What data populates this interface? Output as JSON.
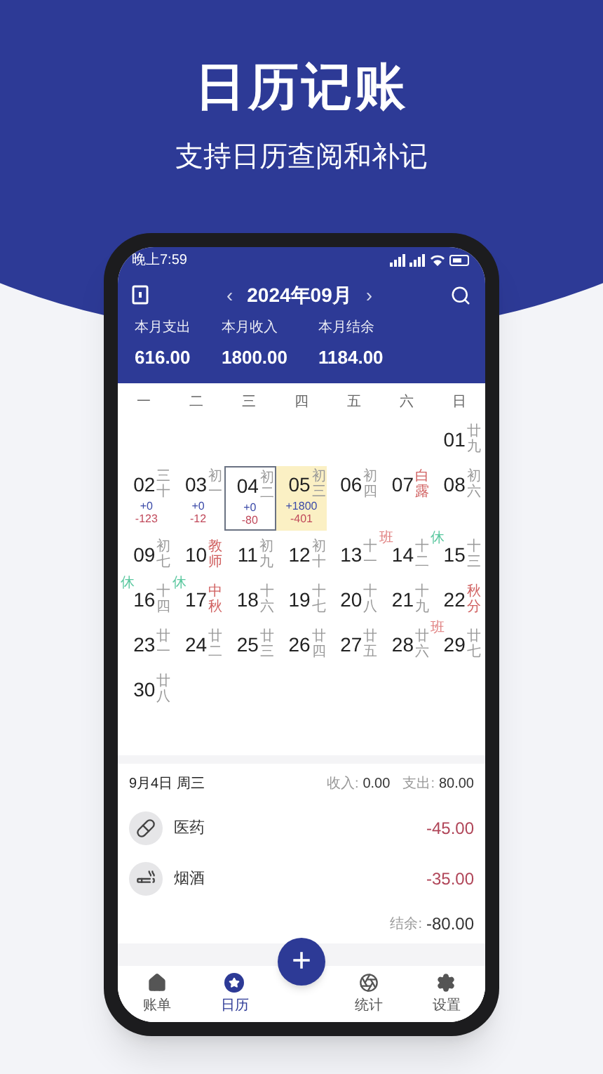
{
  "banner": {
    "title": "日历记账",
    "subtitle": "支持日历查阅和补记"
  },
  "status_bar": {
    "time": "晚上7:59"
  },
  "header": {
    "prev": "‹",
    "month": "2024年09月",
    "next": "›"
  },
  "summary": [
    {
      "label": "本月支出",
      "value": "616.00"
    },
    {
      "label": "本月收入",
      "value": "1800.00"
    },
    {
      "label": "本月结余",
      "value": "1184.00"
    }
  ],
  "weekdays": [
    "一",
    "二",
    "三",
    "四",
    "五",
    "六",
    "日"
  ],
  "days": [
    {
      "kind": "empty"
    },
    {
      "kind": "empty"
    },
    {
      "kind": "empty"
    },
    {
      "kind": "empty"
    },
    {
      "kind": "empty"
    },
    {
      "kind": "empty"
    },
    {
      "kind": "day",
      "day": "01",
      "lunar": "廿九",
      "holiday": false,
      "selected": false,
      "today": false
    },
    {
      "kind": "day",
      "day": "02",
      "lunar": "三十",
      "holiday": false,
      "selected": false,
      "today": false,
      "income": "+0",
      "expense": "-123"
    },
    {
      "kind": "day",
      "day": "03",
      "lunar": "初一",
      "holiday": false,
      "selected": false,
      "today": false,
      "income": "+0",
      "expense": "-12"
    },
    {
      "kind": "day",
      "day": "04",
      "lunar": "初二",
      "holiday": false,
      "selected": true,
      "today": false,
      "income": "+0",
      "expense": "-80"
    },
    {
      "kind": "day",
      "day": "05",
      "lunar": "初三",
      "holiday": false,
      "selected": false,
      "today": true,
      "income": "+1800",
      "expense": "-401"
    },
    {
      "kind": "day",
      "day": "06",
      "lunar": "初四",
      "holiday": false,
      "selected": false,
      "today": false
    },
    {
      "kind": "day",
      "day": "07",
      "lunar": "白露",
      "holiday": true,
      "selected": false,
      "today": false
    },
    {
      "kind": "day",
      "day": "08",
      "lunar": "初六",
      "holiday": false,
      "selected": false,
      "today": false
    },
    {
      "kind": "day",
      "day": "09",
      "lunar": "初七",
      "holiday": false,
      "selected": false,
      "today": false
    },
    {
      "kind": "day",
      "day": "10",
      "lunar": "教师",
      "holiday": true,
      "selected": false,
      "today": false
    },
    {
      "kind": "day",
      "day": "11",
      "lunar": "初九",
      "holiday": false,
      "selected": false,
      "today": false
    },
    {
      "kind": "day",
      "day": "12",
      "lunar": "初十",
      "holiday": false,
      "selected": false,
      "today": false
    },
    {
      "kind": "day",
      "day": "13",
      "lunar": "十一",
      "holiday": false,
      "selected": false,
      "today": false
    },
    {
      "kind": "day",
      "day": "14",
      "lunar": "十二",
      "holiday": false,
      "selected": false,
      "today": false,
      "badge": {
        "text": "班",
        "color": "#e08080"
      }
    },
    {
      "kind": "day",
      "day": "15",
      "lunar": "十三",
      "holiday": false,
      "selected": false,
      "today": false,
      "badge": {
        "text": "休",
        "color": "#5cc8a0"
      }
    },
    {
      "kind": "day",
      "day": "16",
      "lunar": "十四",
      "holiday": false,
      "selected": false,
      "today": false,
      "badge": {
        "text": "休",
        "color": "#5cc8a0"
      }
    },
    {
      "kind": "day",
      "day": "17",
      "lunar": "中秋",
      "holiday": true,
      "selected": false,
      "today": false,
      "badge": {
        "text": "休",
        "color": "#5cc8a0"
      }
    },
    {
      "kind": "day",
      "day": "18",
      "lunar": "十六",
      "holiday": false,
      "selected": false,
      "today": false
    },
    {
      "kind": "day",
      "day": "19",
      "lunar": "十七",
      "holiday": false,
      "selected": false,
      "today": false
    },
    {
      "kind": "day",
      "day": "20",
      "lunar": "十八",
      "holiday": false,
      "selected": false,
      "today": false
    },
    {
      "kind": "day",
      "day": "21",
      "lunar": "十九",
      "holiday": false,
      "selected": false,
      "today": false
    },
    {
      "kind": "day",
      "day": "22",
      "lunar": "秋分",
      "holiday": true,
      "selected": false,
      "today": false
    },
    {
      "kind": "day",
      "day": "23",
      "lunar": "廿一",
      "holiday": false,
      "selected": false,
      "today": false
    },
    {
      "kind": "day",
      "day": "24",
      "lunar": "廿二",
      "holiday": false,
      "selected": false,
      "today": false
    },
    {
      "kind": "day",
      "day": "25",
      "lunar": "廿三",
      "holiday": false,
      "selected": false,
      "today": false
    },
    {
      "kind": "day",
      "day": "26",
      "lunar": "廿四",
      "holiday": false,
      "selected": false,
      "today": false
    },
    {
      "kind": "day",
      "day": "27",
      "lunar": "廿五",
      "holiday": false,
      "selected": false,
      "today": false
    },
    {
      "kind": "day",
      "day": "28",
      "lunar": "廿六",
      "holiday": false,
      "selected": false,
      "today": false
    },
    {
      "kind": "day",
      "day": "29",
      "lunar": "廿七",
      "holiday": false,
      "selected": false,
      "today": false,
      "badge": {
        "text": "班",
        "color": "#e08080"
      }
    },
    {
      "kind": "day",
      "day": "30",
      "lunar": "廿八",
      "holiday": false,
      "selected": false,
      "today": false
    }
  ],
  "detail": {
    "date": "9月4日 周三",
    "income_label": "收入:",
    "income": "0.00",
    "expense_label": "支出:",
    "expense": "80.00",
    "records": [
      {
        "kind": "medicine",
        "name": "医药",
        "amount": "-45.00"
      },
      {
        "kind": "tobacco",
        "name": "烟酒",
        "amount": "-35.00"
      }
    ],
    "balance_label": "结余:",
    "balance": "-80.00"
  },
  "add_button": "+",
  "nav": [
    {
      "kind": "home",
      "label": "账单",
      "selected": false
    },
    {
      "kind": "calendar",
      "label": "日历",
      "selected": true
    },
    {
      "kind": "stats",
      "label": "统计",
      "selected": false
    },
    {
      "kind": "settings",
      "label": "设置",
      "selected": false
    }
  ]
}
